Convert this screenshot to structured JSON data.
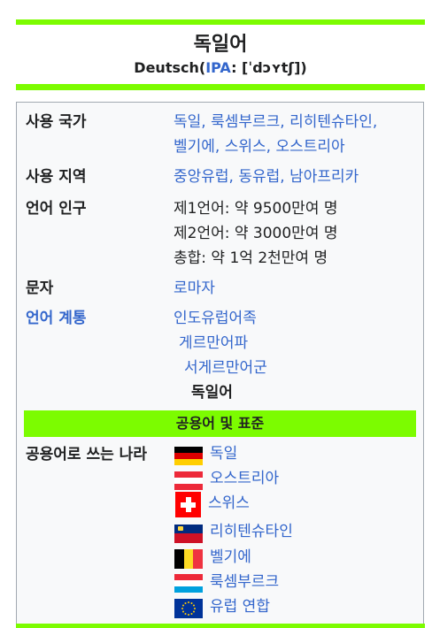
{
  "header": {
    "title": "독일어",
    "subtitle_native": "Deutsch",
    "subtitle_open": "(",
    "ipa_label": "IPA",
    "ipa_text": ": [ˈdɔʏtʃ])"
  },
  "rows": {
    "countries": {
      "label": "사용 국가",
      "line1": "독일, 룩셈부르크, 리히텐슈타인,",
      "line2": "벨기에, 스위스, 오스트리아"
    },
    "region": {
      "label": "사용 지역",
      "value": "중앙유럽, 동유럽, 남아프리카"
    },
    "population": {
      "label": "언어 인구",
      "line1": "제1언어: 약 9500만여 명",
      "line2": "제2언어: 약 3000만여 명",
      "line3": "총합: 약 1억 2천만여 명"
    },
    "script": {
      "label": "문자",
      "value": "로마자"
    },
    "family": {
      "label": "언어 계통",
      "level1": "인도유럽어족",
      "level2": "게르만어파",
      "level3": "서게르만어군",
      "level4": "독일어"
    }
  },
  "official": {
    "section_header": "공용어 및 표준",
    "label": "공용어로 쓰는 나라",
    "countries": [
      {
        "name": "독일",
        "flag": "germany-flag-icon"
      },
      {
        "name": "오스트리아",
        "flag": "austria-flag-icon"
      },
      {
        "name": "스위스",
        "flag": "switzerland-flag-icon"
      },
      {
        "name": "리히텐슈타인",
        "flag": "liechtenstein-flag-icon"
      },
      {
        "name": "벨기에",
        "flag": "belgium-flag-icon"
      },
      {
        "name": "룩셈부르크",
        "flag": "luxembourg-flag-icon"
      },
      {
        "name": "유럽 연합",
        "flag": "eu-flag-icon"
      }
    ]
  },
  "colors": {
    "accent_bar": "#7cfc00",
    "link": "#3366cc",
    "box_bg": "#f8f9fa",
    "border": "#a2a9b1"
  }
}
